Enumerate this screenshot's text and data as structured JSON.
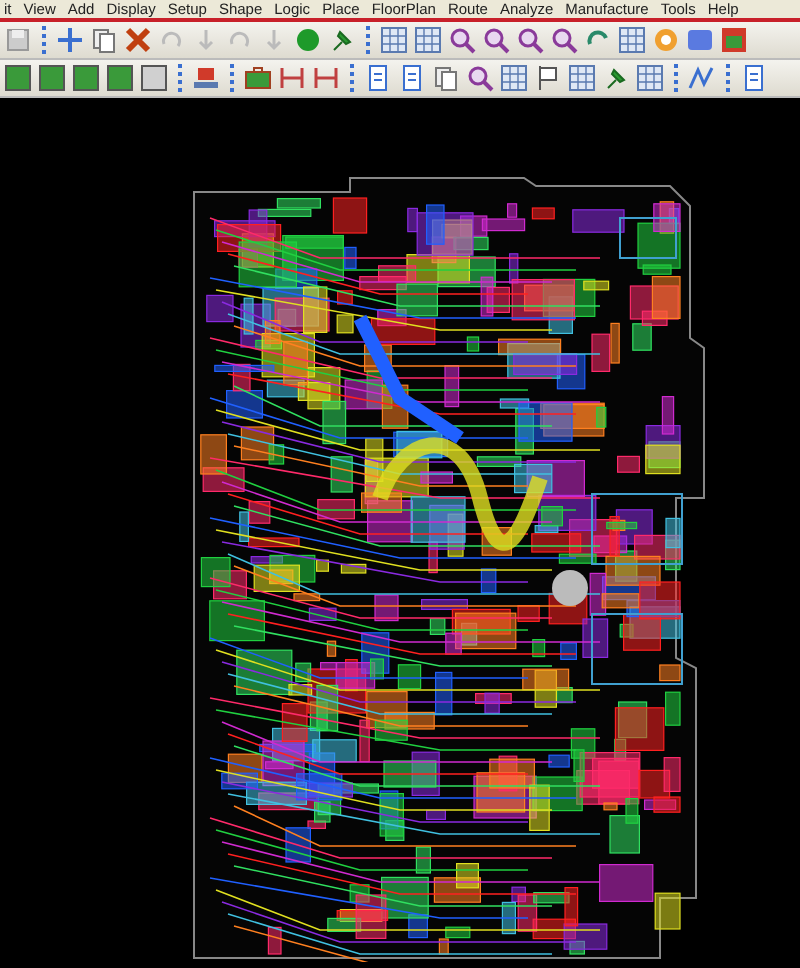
{
  "menu": [
    {
      "label": "it"
    },
    {
      "label": "View"
    },
    {
      "label": "Add"
    },
    {
      "label": "Display"
    },
    {
      "label": "Setup"
    },
    {
      "label": "Shape"
    },
    {
      "label": "Logic"
    },
    {
      "label": "Place"
    },
    {
      "label": "FloorPlan"
    },
    {
      "label": "Route"
    },
    {
      "label": "Analyze"
    },
    {
      "label": "Manufacture"
    },
    {
      "label": "Tools"
    },
    {
      "label": "Help"
    }
  ]
}
